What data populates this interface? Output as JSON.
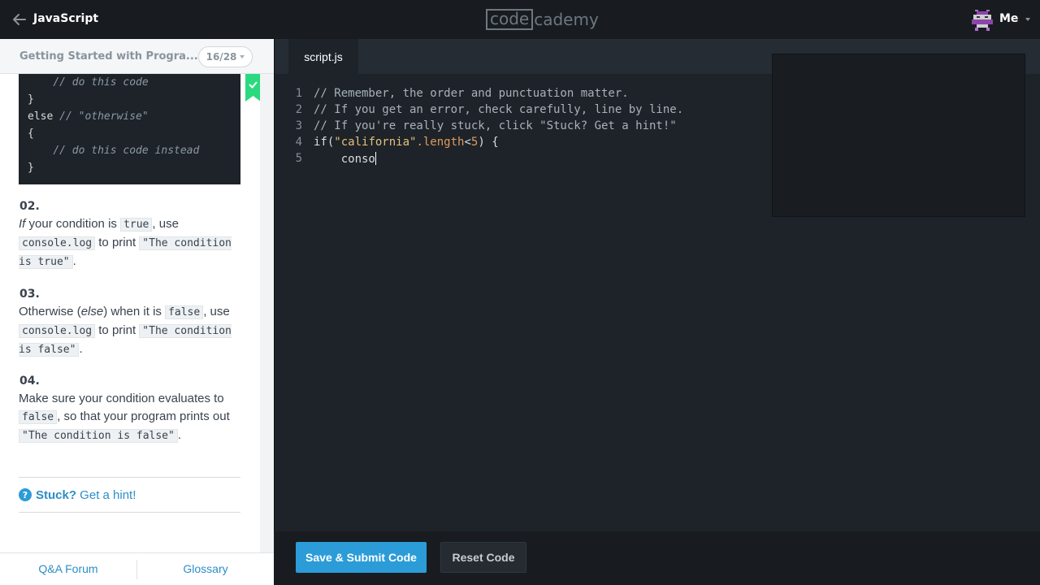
{
  "topbar": {
    "back_icon": "arrow-left-icon",
    "course_title": "JavaScript",
    "logo_box": "code",
    "logo_rest": "cademy",
    "user_label": "Me"
  },
  "lesson": {
    "name": "Getting Started with Progra...",
    "counter": "16/28",
    "code_sample": [
      {
        "indent": "    ",
        "code": "",
        "comment": "// do this code"
      },
      {
        "indent": "",
        "code": "}",
        "comment": ""
      },
      {
        "indent": "",
        "code": "else ",
        "comment": "// \"otherwise\""
      },
      {
        "indent": "",
        "code": "{",
        "comment": ""
      },
      {
        "indent": "    ",
        "code": "",
        "comment": "// do this code instead"
      },
      {
        "indent": "",
        "code": "}",
        "comment": ""
      }
    ],
    "steps": [
      {
        "num": "02.",
        "parts": [
          "If",
          " your condition is ",
          "true",
          ", use ",
          "console.log",
          " to print ",
          "\"The condition is true\"",
          "."
        ]
      },
      {
        "num": "03.",
        "parts": [
          "Otherwise (",
          "else",
          ") when it is ",
          "false",
          ", use ",
          "console.log",
          " to print ",
          "\"The condition is false\"",
          "."
        ]
      },
      {
        "num": "04.",
        "parts": [
          "Make sure your condition evaluates to ",
          "false",
          ", so that your program prints out ",
          "\"The condition is false\"",
          "."
        ]
      }
    ],
    "hint": {
      "stuck": "Stuck?",
      "text": " Get a hint!"
    },
    "footer": {
      "qa": "Q&A Forum",
      "glossary": "Glossary"
    }
  },
  "editor": {
    "tab": "script.js",
    "lines": [
      {
        "num": "1",
        "text": "// Remember, the order and punctuation matter."
      },
      {
        "num": "2",
        "text": "// If you get an error, check carefully, line by line."
      },
      {
        "num": "3",
        "text": "// If you're really stuck, click \"Stuck? Get a hint!\""
      },
      {
        "num": "4",
        "prefix": "if(",
        "str": "\"california\"",
        "prop": ".length",
        "op": "<",
        "num_val": "5",
        "suffix": ") {"
      },
      {
        "num": "5",
        "text": "    conso"
      }
    ]
  },
  "actions": {
    "submit": "Save & Submit Code",
    "reset": "Reset Code"
  },
  "colors": {
    "accent": "#2b9cd8",
    "success": "#2bd97f"
  }
}
